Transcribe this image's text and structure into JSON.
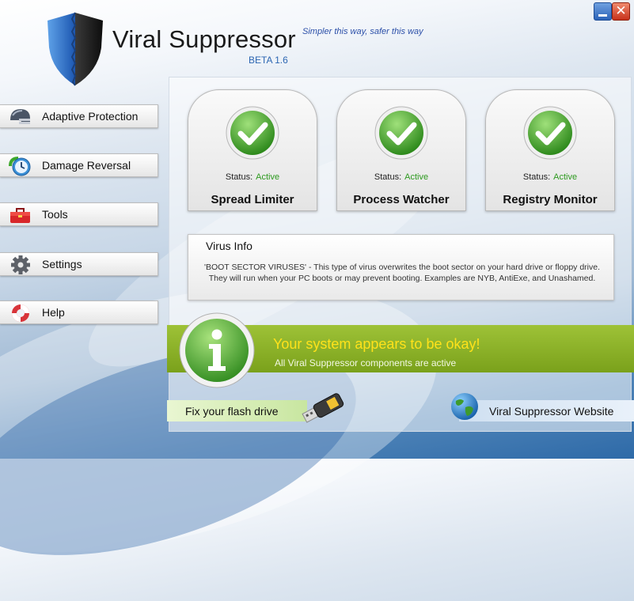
{
  "app": {
    "title": "Viral Suppressor",
    "version": "BETA 1.6",
    "tagline": "Simpler this way, safer this way",
    "icon": "shield-logo"
  },
  "window_controls": {
    "close_glyph": "✕",
    "minimize": "minimize-icon",
    "close": "close-icon"
  },
  "sidebar": {
    "items": [
      {
        "label": "Adaptive Protection",
        "icon": "helmet-icon"
      },
      {
        "label": "Damage Reversal",
        "icon": "clock-restore-icon"
      },
      {
        "label": "Tools",
        "icon": "toolbox-icon"
      },
      {
        "label": "Settings",
        "icon": "gear-icon"
      },
      {
        "label": "Help",
        "icon": "lifebuoy-icon"
      }
    ]
  },
  "modules": [
    {
      "title": "Spread Limiter",
      "status_label": "Status:",
      "status_value": "Active",
      "icon": "check-icon"
    },
    {
      "title": "Process Watcher",
      "status_label": "Status:",
      "status_value": "Active",
      "icon": "check-icon"
    },
    {
      "title": "Registry Monitor",
      "status_label": "Status:",
      "status_value": "Active",
      "icon": "check-icon"
    }
  ],
  "virus_info": {
    "title": "Virus Info",
    "text": "'BOOT SECTOR VIRUSES' - This type of virus overwrites the boot sector on your hard drive or floppy drive. They will run when your PC boots or may prevent booting. Examples are NYB, AntiExe, and Unashamed."
  },
  "status": {
    "headline": "Your system appears to be okay!",
    "subtext": "All Viral Suppressor components are active",
    "icon": "info-icon"
  },
  "footer": {
    "flash_label": "Fix your flash drive",
    "website_label": "Viral Suppressor Website"
  },
  "colors": {
    "accent": "#2c66b2",
    "active_status": "#2d9a1f",
    "banner": "#8bb12a",
    "headline": "#ffe21a"
  }
}
